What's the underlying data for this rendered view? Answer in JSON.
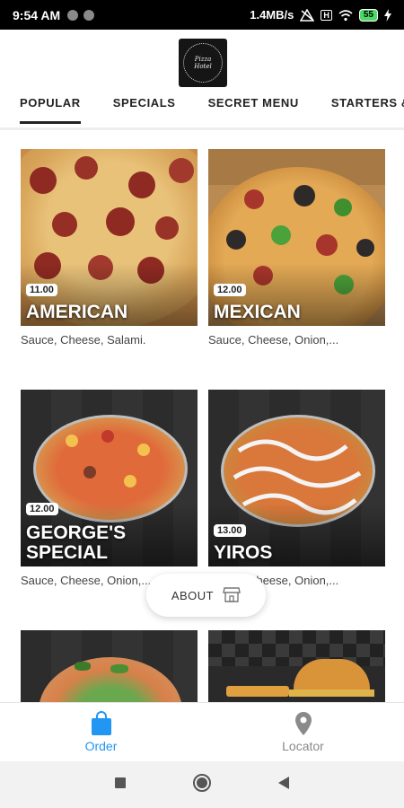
{
  "status_bar": {
    "time": "9:54 AM",
    "speed": "1.4MB/s",
    "hd_label": "H",
    "battery": "55"
  },
  "header": {
    "logo_text_line1": "Pizza",
    "logo_text_line2": "Hotel"
  },
  "tabs": [
    {
      "label": "POPULAR",
      "active": true
    },
    {
      "label": "SPECIALS",
      "active": false
    },
    {
      "label": "SECRET MENU",
      "active": false
    },
    {
      "label": "STARTERS & S",
      "active": false
    }
  ],
  "items": [
    {
      "name": "AMERICAN",
      "price": "11.00",
      "description": "Sauce, Cheese, Salami."
    },
    {
      "name": "MEXICAN",
      "price": "12.00",
      "description": "Sauce, Cheese, Onion,..."
    },
    {
      "name": "GEORGE'S SPECIAL",
      "price": "12.00",
      "description": "Sauce, Cheese, Onion,..."
    },
    {
      "name": "YIROS",
      "price": "13.00",
      "description": "Sauce, Cheese, Onion,..."
    },
    {
      "name": "",
      "price": "",
      "description": ""
    },
    {
      "name": "",
      "price": "",
      "description": ""
    }
  ],
  "about_button": {
    "label": "ABOUT",
    "icon": "storefront-icon"
  },
  "bottom_nav": {
    "order_label": "Order",
    "locator_label": "Locator"
  },
  "colors": {
    "accent": "#2196f3",
    "inactive": "#8a8a8a",
    "status_bar_bg": "#000000"
  }
}
